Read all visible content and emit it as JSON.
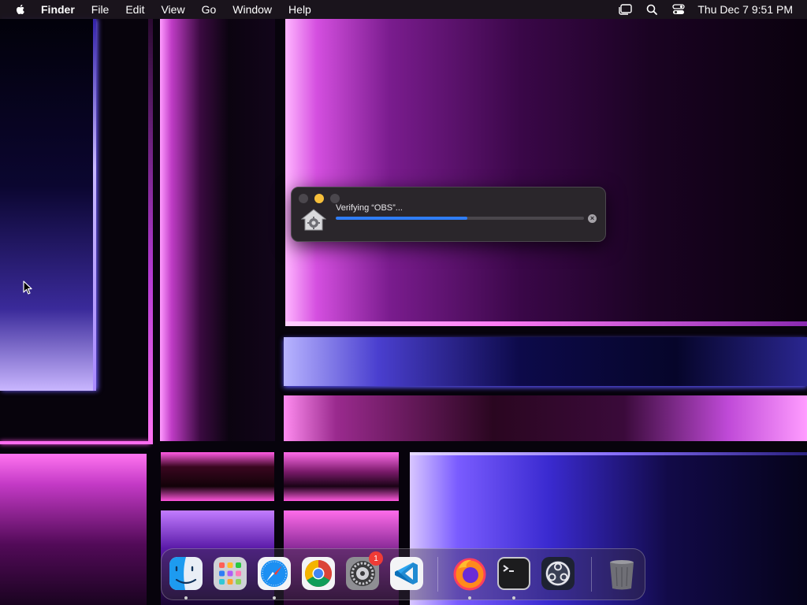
{
  "menubar": {
    "app_name": "Finder",
    "items": [
      "File",
      "Edit",
      "View",
      "Go",
      "Window",
      "Help"
    ],
    "clock": "Thu Dec 7  9:51 PM",
    "status_icons": [
      "stage-manager-icon",
      "search-icon",
      "control-center-icon"
    ]
  },
  "dialog": {
    "title": "Verifying “OBS”...",
    "progress_fraction": 0.53,
    "accent_color": "#2f7df6"
  },
  "dock": {
    "apps": [
      {
        "name": "Finder",
        "icon": "finder-icon",
        "running": true
      },
      {
        "name": "Launchpad",
        "icon": "launchpad-icon",
        "running": false
      },
      {
        "name": "Safari",
        "icon": "safari-icon",
        "running": true
      },
      {
        "name": "Google Chrome",
        "icon": "chrome-icon",
        "running": false
      },
      {
        "name": "System Settings",
        "icon": "system-settings-icon",
        "running": false,
        "badge": "1"
      },
      {
        "name": "Visual Studio Code",
        "icon": "vscode-icon",
        "running": false
      },
      {
        "name": "Firefox",
        "icon": "firefox-icon",
        "running": true
      },
      {
        "name": "Terminal",
        "icon": "terminal-icon",
        "running": true
      },
      {
        "name": "OBS",
        "icon": "obs-icon",
        "running": false
      },
      {
        "name": "Trash",
        "icon": "trash-icon",
        "running": false
      }
    ]
  }
}
